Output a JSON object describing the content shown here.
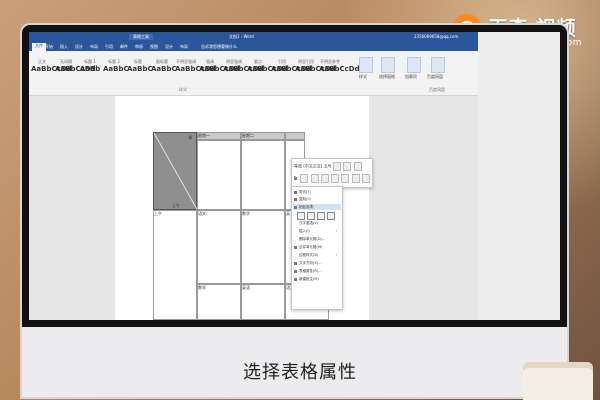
{
  "branding": {
    "logo_mark": "Q",
    "name": "天奇·视频",
    "url": "www.tianqijun.com"
  },
  "caption": "选择表格属性",
  "colors": {
    "word_blue": "#2b579a",
    "logo_orange": "#ff8a1f"
  },
  "word": {
    "title": "文档1 - Word",
    "context_tab": "表格工具",
    "user": "2356069658@qq.com",
    "tabs": [
      "文件",
      "开始",
      "插入",
      "设计",
      "布局",
      "引用",
      "邮件",
      "审阅",
      "视图",
      "设计",
      "布局"
    ],
    "tell_me": "告诉我您想要做什么",
    "styles": [
      {
        "sample": "AaBbCcDd",
        "name": "正文"
      },
      {
        "sample": "AaBbCcDd",
        "name": "无间隔"
      },
      {
        "sample": "AaBb",
        "name": "标题 1"
      },
      {
        "sample": "AaBbC",
        "name": "标题 2"
      },
      {
        "sample": "AaBbC",
        "name": "标题"
      },
      {
        "sample": "AaBbC",
        "name": "副标题"
      },
      {
        "sample": "AaBbCcDd",
        "name": "不明显强调"
      },
      {
        "sample": "AaBbCcDd",
        "name": "强调"
      },
      {
        "sample": "AaBbCcDd",
        "name": "明显强调"
      },
      {
        "sample": "AaBbCcDd",
        "name": "要点"
      },
      {
        "sample": "AaBbCcDd",
        "name": "引用"
      },
      {
        "sample": "AaBbCcDd",
        "name": "明显引用"
      },
      {
        "sample": "AaBbCcDd",
        "name": "不明显参考"
      }
    ],
    "style_group_label": "样式",
    "ribbon_right": [
      {
        "label": "样式"
      },
      {
        "label": "选择窗格"
      },
      {
        "label": "加载项"
      },
      {
        "label": "百度网盘"
      }
    ],
    "ribbon_right_group": "百度网盘",
    "table": {
      "corner_top": "课",
      "corner_bottom": "上午",
      "headers": [
        "星期一",
        "星期二",
        ""
      ],
      "row2": [
        "上午",
        "语文",
        "数学",
        "英"
      ],
      "row3": [
        "",
        "数学",
        "英语",
        "语文"
      ]
    },
    "float_toolbar": {
      "font": "等线 (中文正文)",
      "size": "五号",
      "row2_label": "B"
    },
    "context_menu": [
      {
        "label": "剪切(T)"
      },
      {
        "label": "复制(C)"
      },
      {
        "label": "粘贴选项:"
      },
      {
        "label": "汉字重选(V)"
      },
      {
        "label": "插入(I)",
        "sub": true
      },
      {
        "label": "删除单元格(D)..."
      },
      {
        "label": "合并单元格(M)"
      },
      {
        "label": "边框样式(B)",
        "sub": true
      },
      {
        "label": "文字方向(X)..."
      },
      {
        "label": "表格属性(R)..."
      },
      {
        "label": "新建批注(M)"
      }
    ]
  }
}
